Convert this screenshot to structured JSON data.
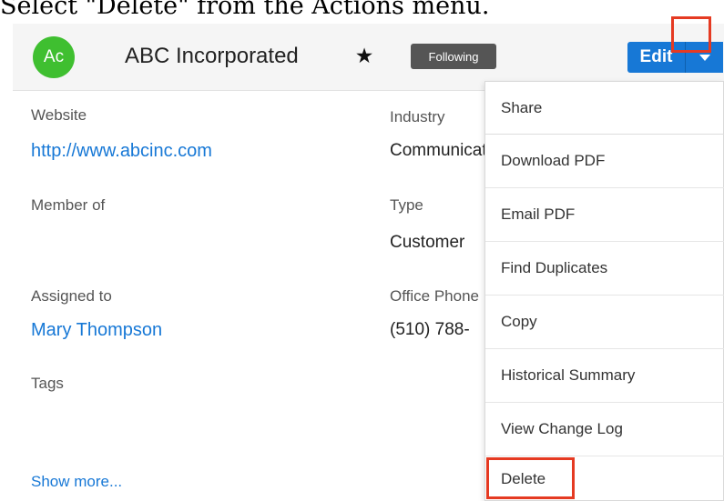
{
  "caption": "Select \"Delete\" from the Actions menu.",
  "header": {
    "avatar_text": "Ac",
    "record_name": "ABC Incorporated",
    "star": "★",
    "following_label": "Following",
    "edit_label": "Edit"
  },
  "fields": {
    "website_label": "Website",
    "website_value": "http://www.abcinc.com",
    "industry_label": "Industry",
    "industry_value": "Communications",
    "member_of_label": "Member of",
    "type_label": "Type",
    "type_value": "Customer",
    "assigned_to_label": "Assigned to",
    "assigned_to_value": "Mary Thompson",
    "office_phone_label": "Office Phone",
    "office_phone_value": "(510) 788-",
    "tags_label": "Tags",
    "show_more_label": "Show more..."
  },
  "actions_menu": {
    "items": [
      {
        "label": "Share"
      },
      {
        "label": "Download PDF"
      },
      {
        "label": "Email PDF"
      },
      {
        "label": "Find Duplicates"
      },
      {
        "label": "Copy"
      },
      {
        "label": "Historical Summary"
      },
      {
        "label": "View Change Log"
      },
      {
        "label": "Delete"
      }
    ],
    "highlighted_item": "Delete"
  },
  "colors": {
    "avatar": "#3fbf30",
    "primary_button": "#1778d6",
    "link": "#1778d6",
    "highlight_border": "#e53a22",
    "following_badge": "#555555"
  }
}
